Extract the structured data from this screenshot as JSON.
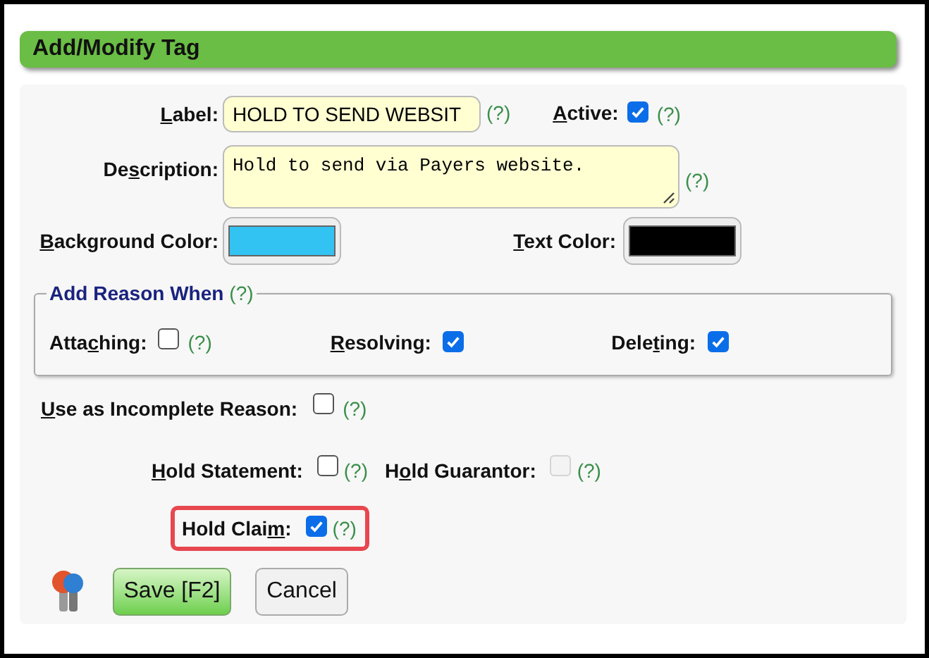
{
  "header": {
    "title": "Add/Modify Tag"
  },
  "label_field": {
    "label_parts": {
      "key": "L",
      "post": "abel:"
    },
    "value": "HOLD TO SEND WEBSIT",
    "help": "(?)"
  },
  "active": {
    "label_parts": {
      "key": "A",
      "post": "ctive:"
    },
    "checked": true,
    "help": "(?)"
  },
  "description": {
    "label_parts": {
      "pre": "De",
      "key": "s",
      "post": "cription:"
    },
    "value": "Hold to send via Payers website.",
    "help": "(?)"
  },
  "background_color": {
    "label_parts": {
      "key": "B",
      "post": "ackground Color:"
    },
    "color": "#33c3f3"
  },
  "text_color": {
    "label_parts": {
      "key": "T",
      "post": "ext Color:"
    },
    "color": "#000000"
  },
  "reason_group": {
    "legend": "Add Reason When",
    "help": "(?)",
    "options": [
      {
        "label_parts": {
          "pre": "Atta",
          "key": "c",
          "post": "hing:"
        },
        "checked": false,
        "help": "(?)"
      },
      {
        "label_parts": {
          "key": "R",
          "post": "esolving:"
        },
        "checked": true
      },
      {
        "label_parts": {
          "pre": "Dele",
          "key": "t",
          "post": "ing:"
        },
        "checked": true
      }
    ]
  },
  "incomplete": {
    "label_parts": {
      "key": "U",
      "post": "se as Incomplete Reason:"
    },
    "checked": false,
    "help": "(?)"
  },
  "holds": [
    {
      "label_parts": {
        "key": "H",
        "post": "old Statement:"
      },
      "checked": false,
      "disabled": false,
      "highlighted": false,
      "help": "(?)"
    },
    {
      "label_parts": {
        "pre": "H",
        "key": "o",
        "post": "ld Guarantor:"
      },
      "checked": false,
      "disabled": true,
      "highlighted": false,
      "help": "(?)"
    },
    {
      "label_parts": {
        "pre": "Hold Clai",
        "key": "m",
        "post": ":"
      },
      "checked": true,
      "disabled": false,
      "highlighted": true,
      "help": "(?)"
    }
  ],
  "buttons": [
    {
      "kind": "primary",
      "label": "Save [F2]"
    },
    {
      "kind": "secondary",
      "label": "Cancel"
    }
  ]
}
